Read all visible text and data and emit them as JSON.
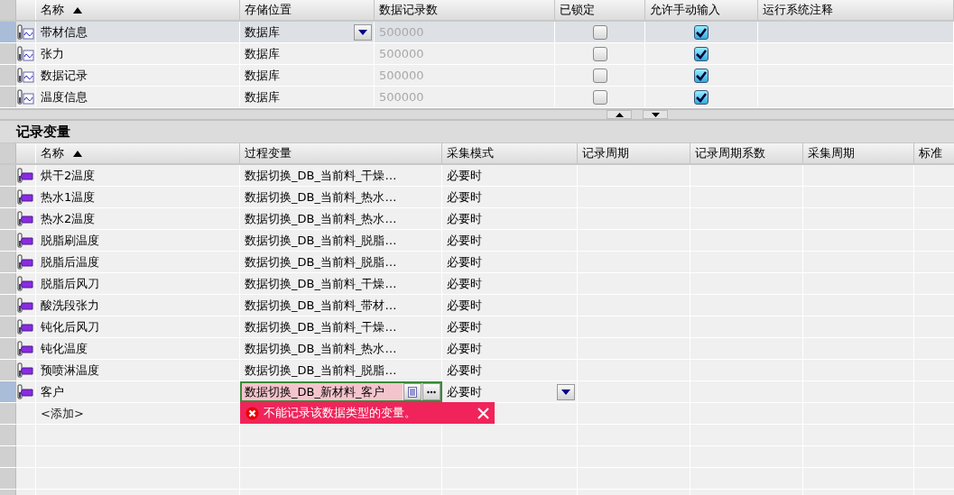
{
  "storage_table": {
    "columns": [
      {
        "label": "名称",
        "sorted": true
      },
      {
        "label": "存储位置",
        "sorted": false
      },
      {
        "label": "数据记录数",
        "sorted": false
      },
      {
        "label": "已锁定",
        "sorted": false
      },
      {
        "label": "允许手动输入",
        "sorted": false
      },
      {
        "label": "运行系统注释",
        "sorted": false
      }
    ],
    "rows": [
      {
        "name": "带材信息",
        "storage": "数据库",
        "record_count": "500000",
        "locked": false,
        "manual_input": true,
        "selected": true
      },
      {
        "name": "张力",
        "storage": "数据库",
        "record_count": "500000",
        "locked": false,
        "manual_input": true,
        "selected": false
      },
      {
        "name": "数据记录",
        "storage": "数据库",
        "record_count": "500000",
        "locked": false,
        "manual_input": true,
        "selected": false
      },
      {
        "name": "温度信息",
        "storage": "数据库",
        "record_count": "500000",
        "locked": false,
        "manual_input": true,
        "selected": false
      }
    ]
  },
  "variables_section": {
    "title": "记录变量",
    "columns": [
      {
        "label": "名称",
        "sorted": true
      },
      {
        "label": "过程变量",
        "sorted": false
      },
      {
        "label": "采集模式",
        "sorted": false
      },
      {
        "label": "记录周期",
        "sorted": false
      },
      {
        "label": "记录周期系数",
        "sorted": false
      },
      {
        "label": "采集周期",
        "sorted": false
      },
      {
        "label": "标准",
        "sorted": false
      }
    ],
    "rows": [
      {
        "name": "烘干2温度",
        "process_tag": "数据切换_DB_当前料_干燥…",
        "mode": "必要时",
        "editing": false
      },
      {
        "name": "热水1温度",
        "process_tag": "数据切换_DB_当前料_热水…",
        "mode": "必要时",
        "editing": false
      },
      {
        "name": "热水2温度",
        "process_tag": "数据切换_DB_当前料_热水…",
        "mode": "必要时",
        "editing": false
      },
      {
        "name": "脱脂刷温度",
        "process_tag": "数据切换_DB_当前料_脱脂…",
        "mode": "必要时",
        "editing": false
      },
      {
        "name": "脱脂后温度",
        "process_tag": "数据切换_DB_当前料_脱脂…",
        "mode": "必要时",
        "editing": false
      },
      {
        "name": "脱脂后风刀",
        "process_tag": "数据切换_DB_当前料_干燥…",
        "mode": "必要时",
        "editing": false
      },
      {
        "name": "酸洗段张力",
        "process_tag": "数据切换_DB_当前料_带材…",
        "mode": "必要时",
        "editing": false
      },
      {
        "name": "钝化后风刀",
        "process_tag": "数据切换_DB_当前料_干燥…",
        "mode": "必要时",
        "editing": false
      },
      {
        "name": "钝化温度",
        "process_tag": "数据切换_DB_当前料_热水…",
        "mode": "必要时",
        "editing": false
      },
      {
        "name": "预喷淋温度",
        "process_tag": "数据切换_DB_当前料_脱脂…",
        "mode": "必要时",
        "editing": false
      },
      {
        "name": "客户",
        "process_tag": "数据切换_DB_新材料_客户",
        "mode": "必要时",
        "editing": true
      }
    ],
    "add_row": "<添加>",
    "error": {
      "message": "不能记录该数据类型的变量。"
    }
  }
}
